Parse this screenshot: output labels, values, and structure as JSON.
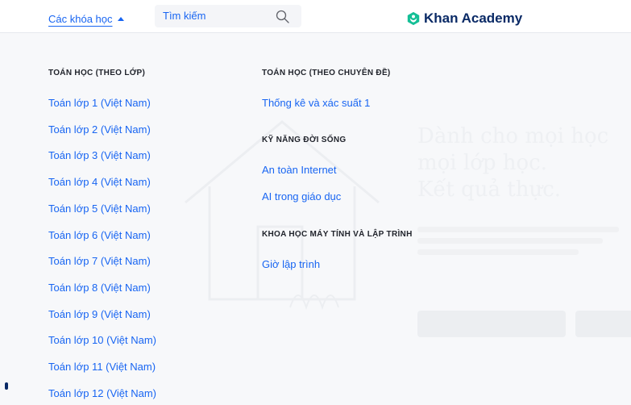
{
  "header": {
    "courses_label": "Các khóa học",
    "search_placeholder": "Tìm kiếm",
    "logo_text": "Khan Academy",
    "icons": {
      "caret": "caret-up-icon",
      "search": "search-icon",
      "logo": "khan-academy-logo-icon"
    }
  },
  "colors": {
    "link": "#1865f2",
    "heading": "#21242c",
    "logo": "#14bf96",
    "logo_text": "#0a2a66"
  },
  "menu": {
    "math_by_grade": {
      "heading": "TOÁN HỌC (THEO LỚP)",
      "items": [
        "Toán lớp 1 (Việt Nam)",
        "Toán lớp 2 (Việt Nam)",
        "Toán lớp 3 (Việt Nam)",
        "Toán lớp 4 (Việt Nam)",
        "Toán lớp 5 (Việt Nam)",
        "Toán lớp 6 (Việt Nam)",
        "Toán lớp 7 (Việt Nam)",
        "Toán lớp 8 (Việt Nam)",
        "Toán lớp 9 (Việt Nam)",
        "Toán lớp 10 (Việt Nam)",
        "Toán lớp 11 (Việt Nam)",
        "Toán lớp 12 (Việt Nam)"
      ]
    },
    "math_by_topic": {
      "heading": "TOÁN HỌC (THEO CHUYÊN ĐỀ)",
      "items": [
        "Thống kê và xác suất 1"
      ]
    },
    "life_skills": {
      "heading": "KỸ NĂNG ĐỜI SỐNG",
      "items": [
        "An toàn Internet",
        "AI trong giáo dục"
      ]
    },
    "computing": {
      "heading": "KHOA HỌC MÁY TÍNH VÀ LẬP TRÌNH",
      "items": [
        "Giờ lập trình"
      ]
    }
  },
  "hero": {
    "headline_lines": [
      "Dành cho mọi học",
      "mọi lớp học.",
      "Kết quả thực."
    ]
  }
}
